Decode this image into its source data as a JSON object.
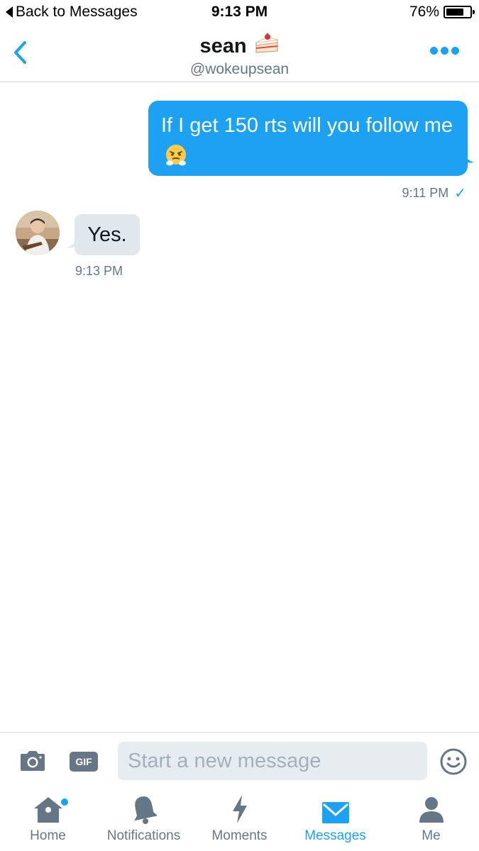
{
  "status_bar": {
    "back_label": "Back to Messages",
    "time": "9:13 PM",
    "battery_percent": "76%",
    "battery_level": 0.76
  },
  "header": {
    "name": "sean",
    "name_emoji": "shortcake-icon",
    "handle": "@wokeupsean",
    "back_icon": "chevron-left-icon",
    "more_icon": "more-dots-icon"
  },
  "messages": [
    {
      "direction": "outgoing",
      "text": "If I get 150 rts will you follow me",
      "emoji": "face-with-steam-icon",
      "time": "9:11 PM",
      "status_icon": "checkmark-icon"
    },
    {
      "direction": "incoming",
      "text": "Yes.",
      "time": "9:13 PM"
    }
  ],
  "composer": {
    "placeholder": "Start a new message",
    "gif_label": "GIF"
  },
  "tabs": [
    {
      "label": "Home",
      "icon": "home-icon",
      "active": false,
      "badge": true
    },
    {
      "label": "Notifications",
      "icon": "bell-icon",
      "active": false
    },
    {
      "label": "Moments",
      "icon": "lightning-icon",
      "active": false
    },
    {
      "label": "Messages",
      "icon": "envelope-icon",
      "active": true
    },
    {
      "label": "Me",
      "icon": "person-icon",
      "active": false
    }
  ],
  "colors": {
    "accent": "#1da1f2",
    "secondary_text": "#657786",
    "incoming_bubble": "#e1e8ed",
    "input_bg": "#e6ecf0"
  }
}
